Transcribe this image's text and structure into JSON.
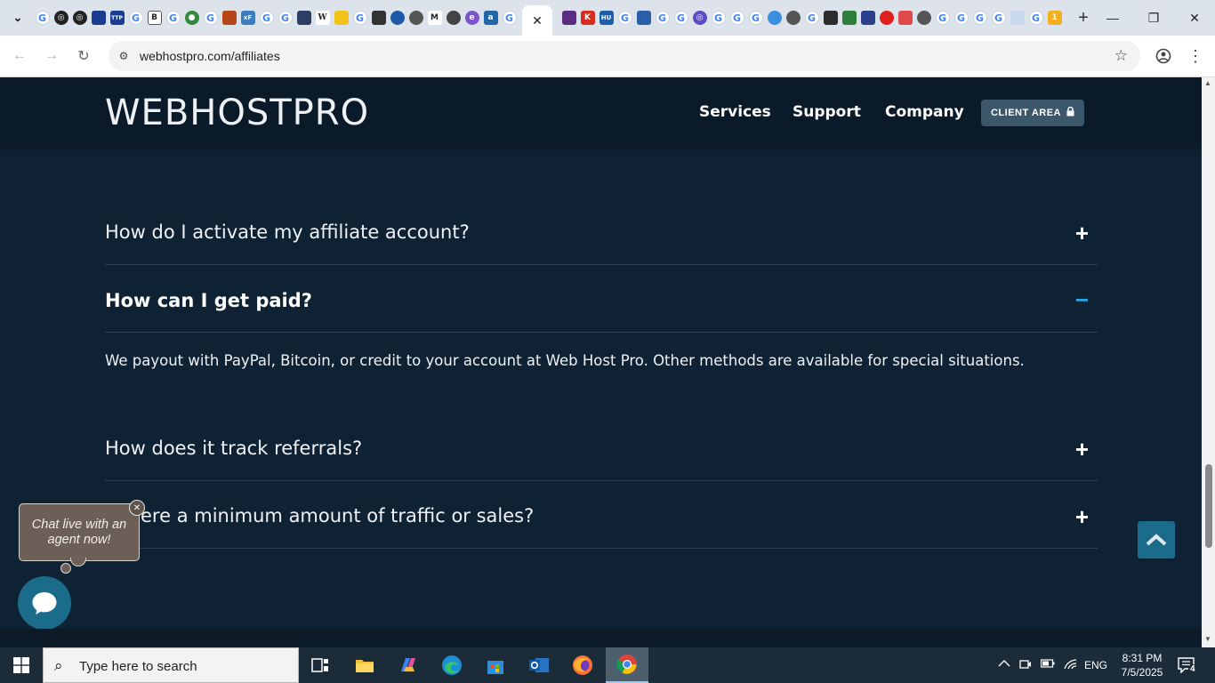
{
  "browser": {
    "tabs": {
      "active_close": "✕",
      "favicon_row": [
        "G",
        "◎",
        "◎",
        "■",
        "TTP",
        "G",
        "B",
        "G",
        "●",
        "G",
        "■",
        "xF",
        "G",
        "G",
        "■",
        "W",
        "■",
        "G",
        "■",
        "■",
        "■",
        "■",
        "M",
        "■",
        "■",
        "■",
        "G"
      ],
      "favicon_row_2": [
        "■",
        "■",
        "HU",
        "G",
        "■",
        "G",
        "G",
        "◎",
        "G",
        "G",
        "G",
        "■",
        "■",
        "G",
        "■",
        "■",
        "■",
        "■",
        "■",
        "G",
        "G",
        "G",
        "G",
        "■",
        "G",
        "■"
      ]
    },
    "url": "webhostpro.com/affiliates"
  },
  "site": {
    "logo": "WEBHOSTPRO",
    "nav": [
      "Services",
      "Support",
      "Company"
    ],
    "client_area": "CLIENT AREA",
    "faq": [
      {
        "question": "How do I activate my affiliate account?",
        "toggle": "+"
      },
      {
        "question": "How can I get paid?",
        "toggle": "−"
      },
      {
        "question": "How does it track referrals?",
        "toggle": "+"
      },
      {
        "question": "ere a minimum amount of traffic or sales?",
        "toggle": "+"
      }
    ],
    "answer": "We payout with PayPal, Bitcoin, or credit to your account at Web Host Pro. Other methods are available for special situations.",
    "chat_prompt": "Chat live with an agent now!"
  },
  "taskbar": {
    "search_placeholder": "Type here to search",
    "language": "ENG",
    "time": "8:31 PM",
    "date": "7/5/2025",
    "notifications": "4"
  },
  "colors": {
    "page_bg": "#0f2233",
    "header_bg": "#0a1a28",
    "accent": "#2aa3df",
    "chat_teal": "#1b6c8b"
  }
}
